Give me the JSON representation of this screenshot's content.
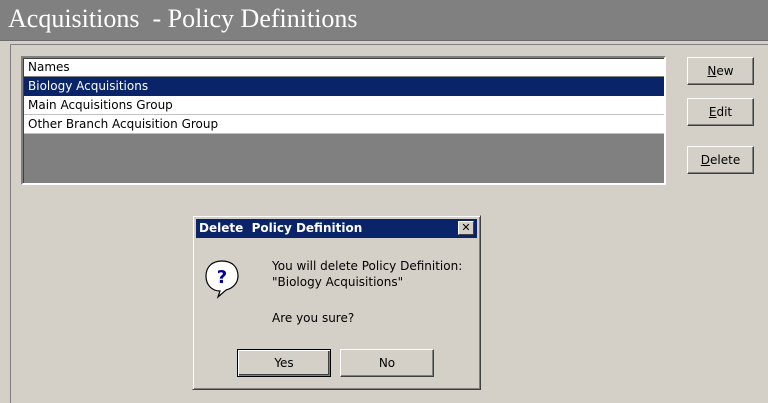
{
  "window": {
    "title": "Acquisitions  - Policy Definitions"
  },
  "list": {
    "header": "Names",
    "rows": [
      {
        "label": "Biology Acquisitions",
        "selected": true
      },
      {
        "label": "Main Acquisitions Group",
        "selected": false
      },
      {
        "label": "Other Branch Acquisition Group",
        "selected": false
      }
    ]
  },
  "buttons": {
    "new_mnemonic": "N",
    "new_rest": "ew",
    "edit_mnemonic": "E",
    "edit_rest": "dit",
    "delete_mnemonic": "D",
    "delete_rest": "elete"
  },
  "dialog": {
    "title": "Delete  Policy Definition",
    "close_glyph": "✕",
    "icon": "question-icon",
    "message_line1": "You will delete  Policy Definition:",
    "message_line2": "\"Biology Acquisitions\"",
    "confirm": "Are you sure?",
    "yes_label": "Yes",
    "no_label": "No"
  },
  "colors": {
    "title_bg": "#808080",
    "selection": "#0a246a",
    "face": "#d4d0c8"
  }
}
